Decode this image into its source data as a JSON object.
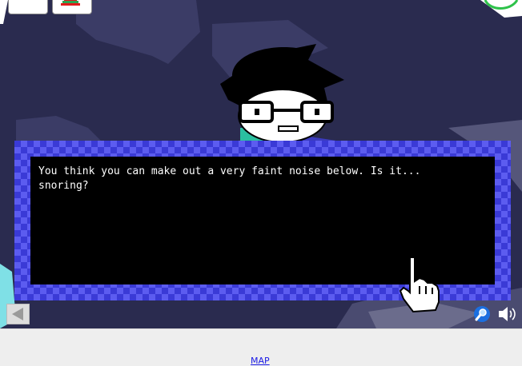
{
  "dialog": {
    "text": "You think you can make out a very faint noise below. Is it...\nsnoring?"
  },
  "footer": {
    "map_label": "MAP"
  },
  "icons": {
    "back": "left-arrow-icon",
    "magnify": "magnifier-icon",
    "sound": "speaker-icon",
    "cursor": "hand-pointer-icon"
  },
  "colors": {
    "scene_bg": "#2a2b4f",
    "frame_blue": "#3a3ad6",
    "frame_light": "#5c5cf0",
    "text": "#ffffff",
    "link": "#1a1ae6"
  }
}
